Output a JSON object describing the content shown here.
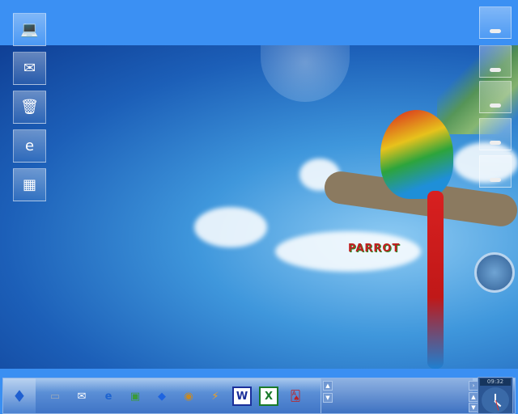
{
  "desktop": {
    "left_icons": [
      {
        "name": "my-computer",
        "glyph": "💻"
      },
      {
        "name": "mail",
        "glyph": "✉"
      },
      {
        "name": "recycle-bin",
        "glyph": "🗑"
      },
      {
        "name": "internet-explorer",
        "glyph": "e"
      },
      {
        "name": "control-panel",
        "glyph": "▦"
      }
    ],
    "right_icons": 5,
    "wallpaper_text": "PARROT"
  },
  "taskbar": {
    "quick_launch": [
      {
        "name": "my-computer",
        "glyph": "▭",
        "color": "#9aa8b8"
      },
      {
        "name": "mail",
        "glyph": "✉",
        "color": "#ffffff"
      },
      {
        "name": "internet-explorer",
        "glyph": "e",
        "color": "#1e64d0"
      },
      {
        "name": "picture-viewer",
        "glyph": "▣",
        "color": "#3a9a3a"
      },
      {
        "name": "diamond-app",
        "glyph": "◆",
        "color": "#1e64e0"
      },
      {
        "name": "media-player",
        "glyph": "◉",
        "color": "#c98a20"
      },
      {
        "name": "winamp",
        "glyph": "⚡",
        "color": "#f0a020"
      },
      {
        "name": "word",
        "glyph": "W",
        "color": "#1a2f9a"
      },
      {
        "name": "excel",
        "glyph": "X",
        "color": "#1a7a2a"
      },
      {
        "name": "solitaire",
        "glyph": "🂡",
        "color": "#c02020"
      }
    ],
    "clock_time": "09:32"
  }
}
